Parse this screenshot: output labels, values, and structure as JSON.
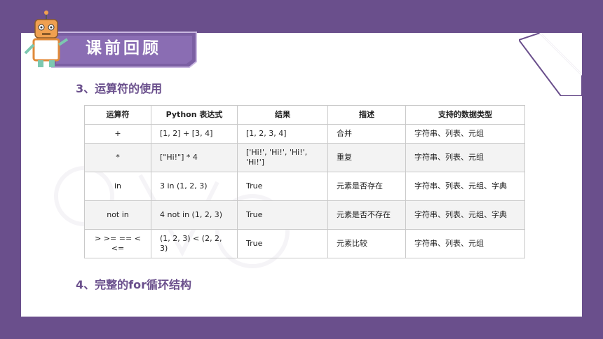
{
  "banner": {
    "title": "课前回顾"
  },
  "section3": {
    "title": "3、运算符的使用"
  },
  "section4": {
    "title": "4、完整的for循环结构"
  },
  "table": {
    "headers": [
      "运算符",
      "Python 表达式",
      "结果",
      "描述",
      "支持的数据类型"
    ],
    "rows": [
      [
        "+",
        "[1, 2] + [3, 4]",
        "[1, 2, 3, 4]",
        "合并",
        "字符串、列表、元组"
      ],
      [
        "*",
        "[\"Hi!\"] * 4",
        "['Hi!', 'Hi!', 'Hi!', 'Hi!']",
        "重复",
        "字符串、列表、元组"
      ],
      [
        "in",
        "3 in (1, 2, 3)",
        "True",
        "元素是否存在",
        "字符串、列表、元组、字典"
      ],
      [
        "not in",
        "4 not in (1, 2, 3)",
        "True",
        "元素是否不存在",
        "字符串、列表、元组、字典"
      ],
      [
        "> >= == < <=",
        "(1, 2, 3) < (2, 2, 3)",
        "True",
        "元素比较",
        "字符串、列表、元组"
      ]
    ]
  }
}
